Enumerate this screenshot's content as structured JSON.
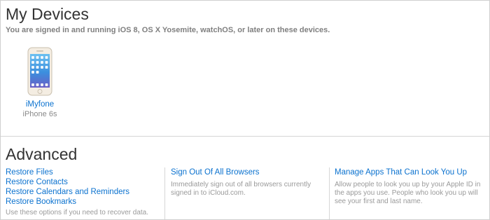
{
  "my_devices": {
    "title": "My Devices",
    "subtitle": "You are signed in and running iOS 8, OS X Yosemite, watchOS, or later on these devices.",
    "devices": [
      {
        "name": "iMyfone",
        "model": "iPhone 6s",
        "icon": "iphone-icon"
      }
    ]
  },
  "advanced": {
    "title": "Advanced",
    "restore_links": [
      "Restore Files",
      "Restore Contacts",
      "Restore Calendars and Reminders",
      "Restore Bookmarks"
    ],
    "restore_description": "Use these options if you need to recover data.",
    "sign_out": {
      "label": "Sign Out Of All Browsers",
      "description": "Immediately sign out of all browsers currently signed in to iCloud.com."
    },
    "manage_apps": {
      "label": "Manage Apps That Can Look You Up",
      "description": "Allow people to look you up by your Apple ID in the apps you use. People who look you up will see your first and last name."
    }
  },
  "colors": {
    "link": "#0b72cf",
    "muted": "#8a8a8a",
    "divider": "#d6d6d6"
  }
}
